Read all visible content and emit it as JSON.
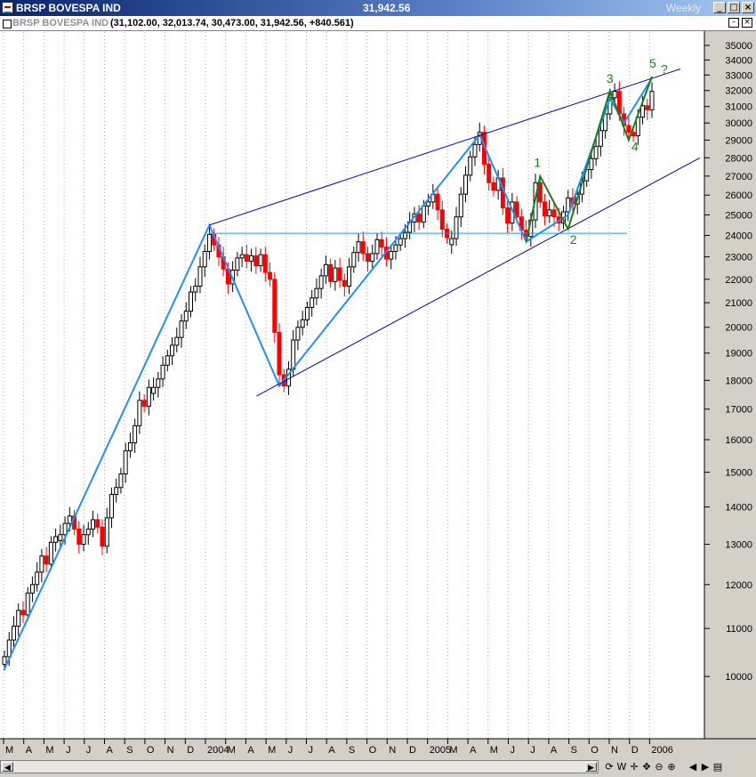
{
  "window": {
    "title": "BRSP BOVESPA IND",
    "last_value": "31,942.56",
    "period": "Weekly"
  },
  "chart_header": {
    "name": "BRSP BOVESPA IND",
    "ohlc": "(31,102.00, 32,013.74, 30,473.00, 31,942.56, +840.561)"
  },
  "toolbar": {
    "icons": [
      "refresh-icon",
      "weekly-label",
      "crosshair-icon",
      "pan-icon",
      "zoom-out-icon",
      "zoom-in-icon",
      "scroll-left-icon",
      "scroll-right-icon",
      "panel-icon"
    ],
    "weekly_label": "W"
  },
  "colors": {
    "up_candle": "#000000",
    "down_candle": "#ff0000",
    "trendline_light": "#1e90ff",
    "trendline_dark": "#0000aa",
    "wave_green": "#1a7f1a",
    "grid": "#b0b0b0"
  },
  "chart_data": {
    "type": "candlestick",
    "y_scale": "log",
    "ylim": [
      9000,
      35700
    ],
    "grid": "vertical dotted",
    "y_ticks": [
      10000,
      11000,
      12000,
      13000,
      14000,
      15000,
      16000,
      17000,
      18000,
      19000,
      20000,
      21000,
      22000,
      23000,
      24000,
      25000,
      26000,
      27000,
      28000,
      29000,
      30000,
      31000,
      32000,
      33000,
      34000,
      35000
    ],
    "x_labels": [
      "M",
      "A",
      "M",
      "J",
      "J",
      "A",
      "S",
      "O",
      "N",
      "D",
      "2004",
      "M",
      "A",
      "M",
      "J",
      "J",
      "A",
      "S",
      "O",
      "N",
      "D",
      "2005",
      "M",
      "A",
      "M",
      "J",
      "J",
      "A",
      "S",
      "O",
      "N",
      "D",
      "2006"
    ],
    "closes": [
      10400,
      10750,
      11050,
      11400,
      11300,
      11800,
      12000,
      12300,
      12700,
      12500,
      13050,
      13200,
      13250,
      13550,
      13750,
      13400,
      13000,
      13250,
      13400,
      13650,
      13450,
      12950,
      13700,
      14350,
      14550,
      14950,
      15650,
      15900,
      16450,
      17300,
      17100,
      17750,
      17750,
      18050,
      18550,
      18900,
      19300,
      19600,
      20250,
      20650,
      21450,
      21700,
      22550,
      23250,
      24050,
      23550,
      23000,
      22450,
      21800,
      22400,
      22950,
      23100,
      22800,
      23050,
      22600,
      23100,
      22300,
      22000,
      19800,
      18200,
      17800,
      18400,
      19500,
      20000,
      20300,
      20800,
      21200,
      21600,
      22150,
      22650,
      21900,
      22500,
      21950,
      21700,
      22550,
      23200,
      23700,
      23150,
      22800,
      23150,
      23800,
      23450,
      22900,
      23250,
      23550,
      23850,
      24150,
      24650,
      25050,
      24650,
      25450,
      25650,
      26050,
      25250,
      24300,
      23900,
      23850,
      24900,
      26050,
      27050,
      28050,
      28750,
      29450,
      27650,
      26650,
      26250,
      26900,
      25350,
      24600,
      25650,
      24900,
      24250,
      23950,
      24750,
      26650,
      25650,
      24950,
      25250,
      24900,
      24600,
      25150,
      25850,
      25550,
      26050,
      26750,
      27350,
      27950,
      28650,
      29550,
      30550,
      31550,
      31950,
      30550,
      29850,
      29450,
      29250,
      30350,
      31050,
      30800,
      31950
    ],
    "annotations": {
      "wave_labels": [
        "1",
        "2",
        "3",
        "4",
        "5",
        "?"
      ]
    }
  }
}
